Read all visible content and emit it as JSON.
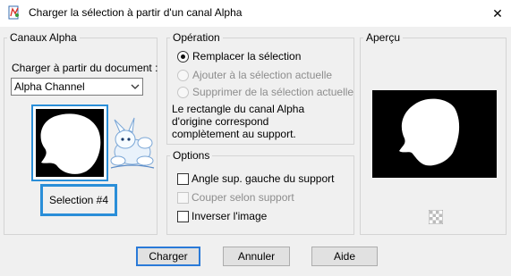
{
  "window": {
    "title": "Charger la sélection à partir d'un canal Alpha",
    "close_glyph": "✕"
  },
  "canaux": {
    "group_label": "Canaux Alpha",
    "load_from_label": "Charger à partir du document :",
    "document_value": "Alpha Channel",
    "dropdown_icon": "chevron-down-icon",
    "selection_name": "Selection #4"
  },
  "operation": {
    "group_label": "Opération",
    "options": [
      {
        "label": "Remplacer la sélection",
        "selected": true,
        "enabled": true
      },
      {
        "label": "Ajouter à la sélection actuelle",
        "selected": false,
        "enabled": false
      },
      {
        "label": "Supprimer de la sélection actuelle",
        "selected": false,
        "enabled": false
      }
    ],
    "info_line1": "Le rectangle du canal Alpha",
    "info_line2": "d'origine correspond",
    "info_line3": "complètement au support."
  },
  "options": {
    "group_label": "Options",
    "checkboxes": [
      {
        "label": "Angle sup. gauche du support",
        "checked": false,
        "enabled": true
      },
      {
        "label": "Couper selon support",
        "checked": false,
        "enabled": false
      },
      {
        "label": "Inverser l'image",
        "checked": false,
        "enabled": true
      }
    ]
  },
  "apercu": {
    "group_label": "Aperçu",
    "transparency_icon": "checkerboard-icon"
  },
  "buttons": {
    "load": "Charger",
    "cancel": "Annuler",
    "help": "Aide"
  },
  "colors": {
    "accent": "#2a8ed8",
    "default_button_border": "#2a7ad8"
  }
}
